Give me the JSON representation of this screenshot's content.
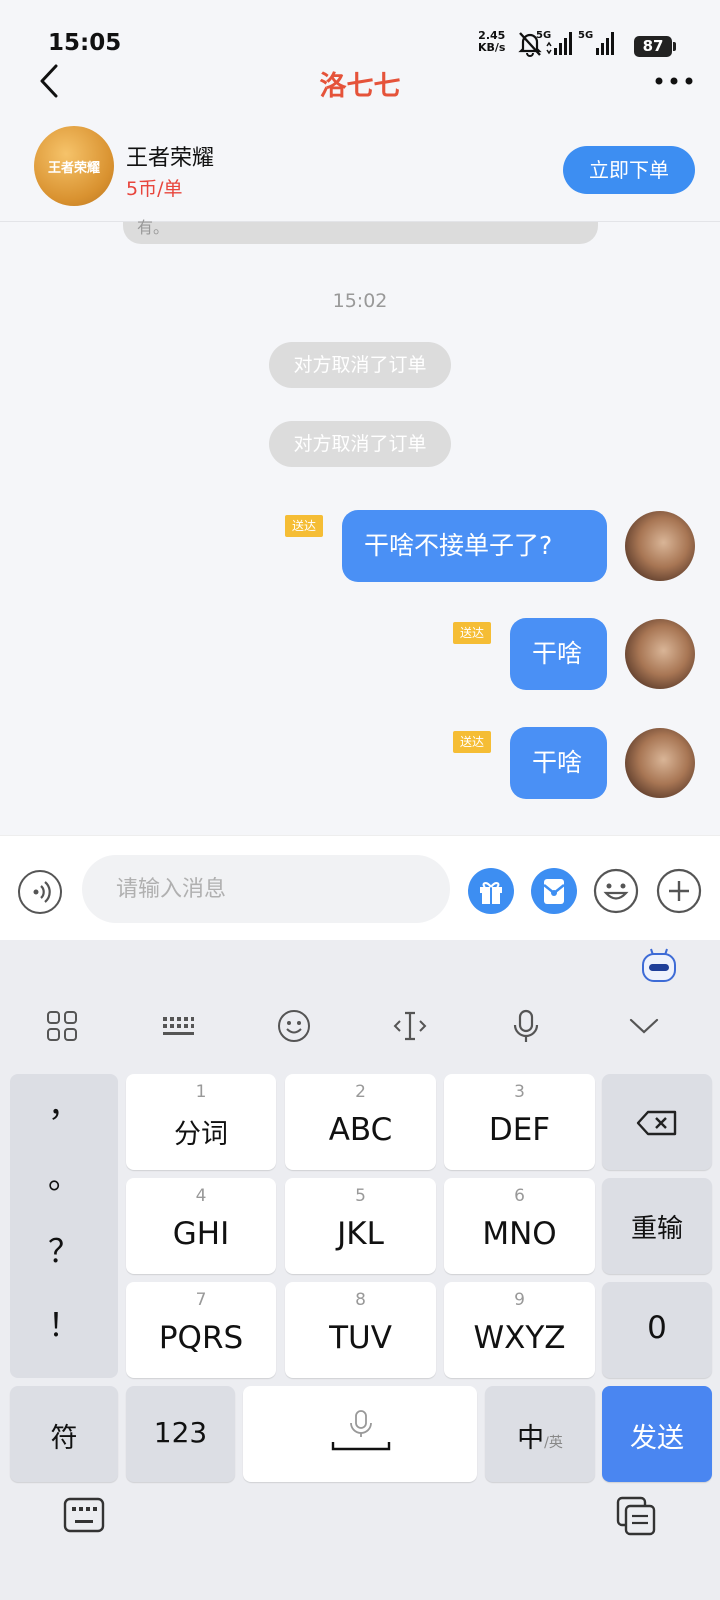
{
  "status": {
    "time": "15:05",
    "net_speed": "2.45",
    "net_unit": "KB/s",
    "gen1": "5G",
    "gen2": "5G",
    "battery": "87"
  },
  "header": {
    "title": "洛七七"
  },
  "product": {
    "logo_text": "王者荣耀",
    "name": "王者荣耀",
    "price": "5币/单",
    "order_button": "立即下单"
  },
  "chat": {
    "prev_bubble_fragment": "有。",
    "timestamp": "15:02",
    "system_messages": [
      "对方取消了订单",
      "对方取消了订单"
    ],
    "messages": [
      {
        "text": "干啥不接单子了?",
        "status": "送达"
      },
      {
        "text": "干啥",
        "status": "送达"
      },
      {
        "text": "干啥",
        "status": "送达"
      }
    ]
  },
  "input": {
    "placeholder": "请输入消息"
  },
  "keyboard": {
    "punctuation": [
      "，",
      "。",
      "？",
      "！"
    ],
    "keys": [
      {
        "num": "1",
        "label": "分词"
      },
      {
        "num": "2",
        "label": "ABC"
      },
      {
        "num": "3",
        "label": "DEF"
      },
      {
        "num": "4",
        "label": "GHI"
      },
      {
        "num": "5",
        "label": "JKL"
      },
      {
        "num": "6",
        "label": "MNO"
      },
      {
        "num": "7",
        "label": "PQRS"
      },
      {
        "num": "8",
        "label": "TUV"
      },
      {
        "num": "9",
        "label": "WXYZ"
      }
    ],
    "reinput": "重输",
    "zero": "0",
    "symbols": "符",
    "numbers": "123",
    "lang_main": "中",
    "lang_sub": "/英",
    "send": "发送"
  },
  "colors": {
    "accent": "#4a90f5",
    "title": "#e5533a",
    "price": "#e8453c",
    "delivered_tag": "#f5bd35"
  }
}
